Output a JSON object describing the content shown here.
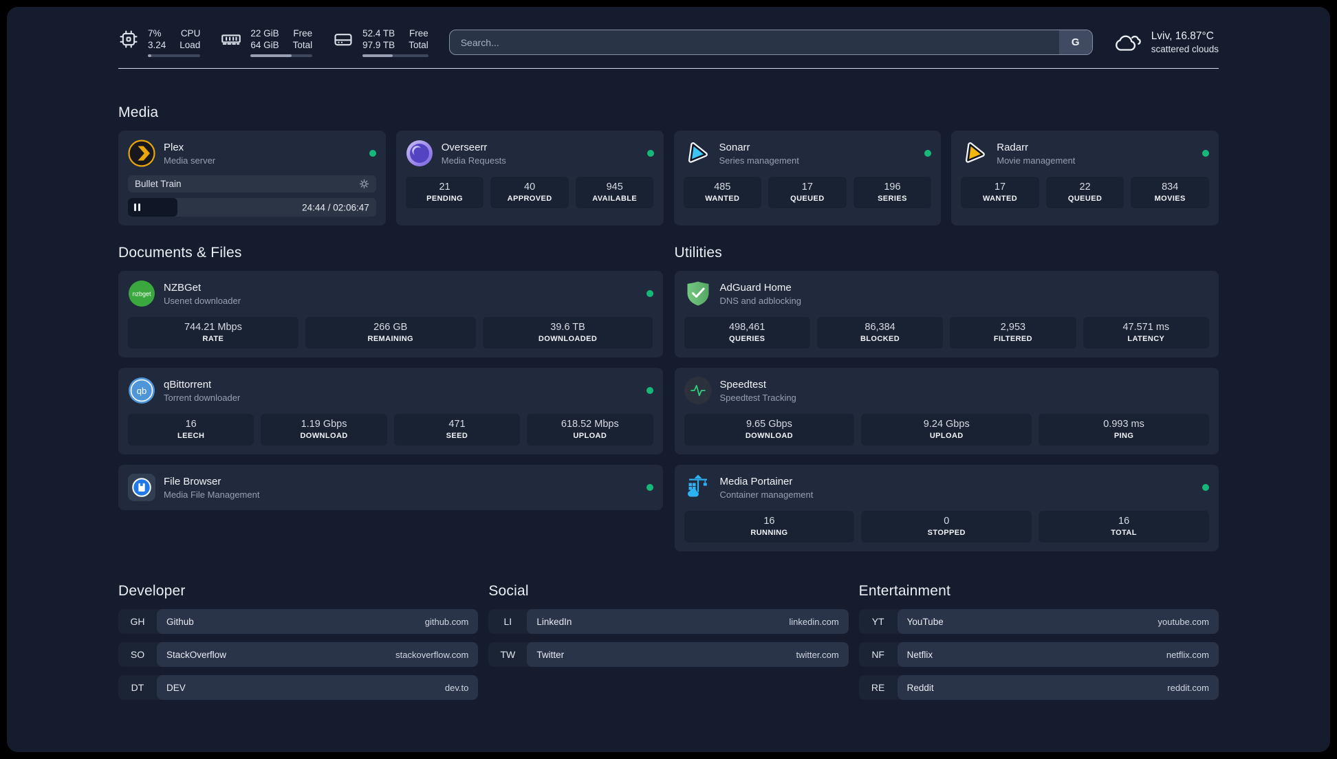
{
  "colors": {
    "page_background": "#151c2d",
    "card_background": "#202a3c",
    "stat_background": "#192233",
    "status_online": "#16b87a",
    "divider": "#d9dfe9",
    "plex_gold": "#e8a50c",
    "sonarr_blue": "#3cc5f4",
    "radarr_yellow": "#f6b70d",
    "nzbget_green": "#3aa83e",
    "qbittorrent_blue": "#4f96d9",
    "filebrowser_blue": "#2079e8",
    "adguard_green": "#64b873",
    "speedtest_green": "#2fcf7c",
    "portainer_blue": "#2bb3f2"
  },
  "topbar": {
    "cpu": {
      "value_top": "7%",
      "value_bottom": "3.24",
      "label_top": "CPU",
      "label_bottom": "Load",
      "progress_percent": 7
    },
    "memory": {
      "value_top": "22 GiB",
      "value_bottom": "64 GiB",
      "label_top": "Free",
      "label_bottom": "Total",
      "progress_percent": 66
    },
    "disk": {
      "value_top": "52.4 TB",
      "value_bottom": "97.9 TB",
      "label_top": "Free",
      "label_bottom": "Total",
      "progress_percent": 46
    },
    "search": {
      "placeholder": "Search...",
      "button_label": "G"
    },
    "weather": {
      "summary": "Lviv, 16.87°C",
      "description": "scattered clouds"
    }
  },
  "media": {
    "title": "Media",
    "plex": {
      "name": "Plex",
      "description": "Media server",
      "status": "online",
      "player": {
        "title": "Bullet Train",
        "state": "paused",
        "time_display": "24:44 / 02:06:47",
        "progress_percent": 20
      }
    },
    "overseerr": {
      "name": "Overseerr",
      "description": "Media Requests",
      "status": "online",
      "stats": [
        {
          "value": "21",
          "label": "PENDING"
        },
        {
          "value": "40",
          "label": "APPROVED"
        },
        {
          "value": "945",
          "label": "AVAILABLE"
        }
      ]
    },
    "sonarr": {
      "name": "Sonarr",
      "description": "Series management",
      "status": "online",
      "stats": [
        {
          "value": "485",
          "label": "WANTED"
        },
        {
          "value": "17",
          "label": "QUEUED"
        },
        {
          "value": "196",
          "label": "SERIES"
        }
      ]
    },
    "radarr": {
      "name": "Radarr",
      "description": "Movie management",
      "status": "online",
      "stats": [
        {
          "value": "17",
          "label": "WANTED"
        },
        {
          "value": "22",
          "label": "QUEUED"
        },
        {
          "value": "834",
          "label": "MOVIES"
        }
      ]
    }
  },
  "documents": {
    "title": "Documents & Files",
    "nzbget": {
      "name": "NZBGet",
      "description": "Usenet downloader",
      "status": "online",
      "stats": [
        {
          "value": "744.21 Mbps",
          "label": "RATE"
        },
        {
          "value": "266 GB",
          "label": "REMAINING"
        },
        {
          "value": "39.6 TB",
          "label": "DOWNLOADED"
        }
      ]
    },
    "qbittorrent": {
      "name": "qBittorrent",
      "description": "Torrent downloader",
      "status": "online",
      "stats": [
        {
          "value": "16",
          "label": "LEECH"
        },
        {
          "value": "1.19 Gbps",
          "label": "DOWNLOAD"
        },
        {
          "value": "471",
          "label": "SEED"
        },
        {
          "value": "618.52 Mbps",
          "label": "UPLOAD"
        }
      ]
    },
    "filebrowser": {
      "name": "File Browser",
      "description": "Media File Management",
      "status": "online"
    }
  },
  "utilities": {
    "title": "Utilities",
    "adguard": {
      "name": "AdGuard Home",
      "description": "DNS and adblocking",
      "stats": [
        {
          "value": "498,461",
          "label": "QUERIES"
        },
        {
          "value": "86,384",
          "label": "BLOCKED"
        },
        {
          "value": "2,953",
          "label": "FILTERED"
        },
        {
          "value": "47.571 ms",
          "label": "LATENCY"
        }
      ]
    },
    "speedtest": {
      "name": "Speedtest",
      "description": "Speedtest Tracking",
      "stats": [
        {
          "value": "9.65 Gbps",
          "label": "DOWNLOAD"
        },
        {
          "value": "9.24 Gbps",
          "label": "UPLOAD"
        },
        {
          "value": "0.993 ms",
          "label": "PING"
        }
      ]
    },
    "portainer": {
      "name": "Media Portainer",
      "description": "Container management",
      "status": "online",
      "stats": [
        {
          "value": "16",
          "label": "RUNNING"
        },
        {
          "value": "0",
          "label": "STOPPED"
        },
        {
          "value": "16",
          "label": "TOTAL"
        }
      ]
    }
  },
  "bookmarks": {
    "developer": {
      "title": "Developer",
      "items": [
        {
          "abbr": "GH",
          "name": "Github",
          "url": "github.com"
        },
        {
          "abbr": "SO",
          "name": "StackOverflow",
          "url": "stackoverflow.com"
        },
        {
          "abbr": "DT",
          "name": "DEV",
          "url": "dev.to"
        }
      ]
    },
    "social": {
      "title": "Social",
      "items": [
        {
          "abbr": "LI",
          "name": "LinkedIn",
          "url": "linkedin.com"
        },
        {
          "abbr": "TW",
          "name": "Twitter",
          "url": "twitter.com"
        }
      ]
    },
    "entertainment": {
      "title": "Entertainment",
      "items": [
        {
          "abbr": "YT",
          "name": "YouTube",
          "url": "youtube.com"
        },
        {
          "abbr": "NF",
          "name": "Netflix",
          "url": "netflix.com"
        },
        {
          "abbr": "RE",
          "name": "Reddit",
          "url": "reddit.com"
        }
      ]
    }
  }
}
